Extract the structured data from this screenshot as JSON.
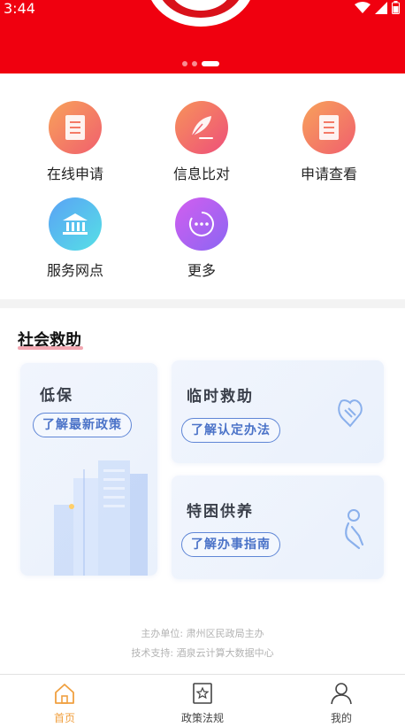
{
  "status_bar": {
    "time": "3:44"
  },
  "banner": {
    "carousel_active_index": 2,
    "carousel_count": 3
  },
  "menu": {
    "items": [
      {
        "label": "在线申请",
        "icon": "document-icon"
      },
      {
        "label": "信息比对",
        "icon": "feather-pen-icon"
      },
      {
        "label": "申请查看",
        "icon": "document-icon"
      },
      {
        "label": "服务网点",
        "icon": "bank-building-icon"
      },
      {
        "label": "更多",
        "icon": "more-dots-icon"
      }
    ]
  },
  "section": {
    "title": "社会救助",
    "cards": [
      {
        "title": "低保",
        "button": "了解最新政策"
      },
      {
        "title": "临时救助",
        "button": "了解认定办法"
      },
      {
        "title": "特困供养",
        "button": "了解办事指南"
      }
    ]
  },
  "footer": {
    "sponsor": "主办单位: 肃州区民政局主办",
    "tech_support": "技术支持: 酒泉云计算大数据中心"
  },
  "tabbar": {
    "tabs": [
      {
        "label": "首页",
        "icon": "home-icon",
        "active": true
      },
      {
        "label": "政策法规",
        "icon": "policy-star-icon",
        "active": false
      },
      {
        "label": "我的",
        "icon": "user-icon",
        "active": false
      }
    ]
  },
  "colors": {
    "banner": "#f0000f",
    "tab_active": "#f0a040",
    "tab_inactive": "#444444",
    "card_accent": "#5f86d6"
  }
}
